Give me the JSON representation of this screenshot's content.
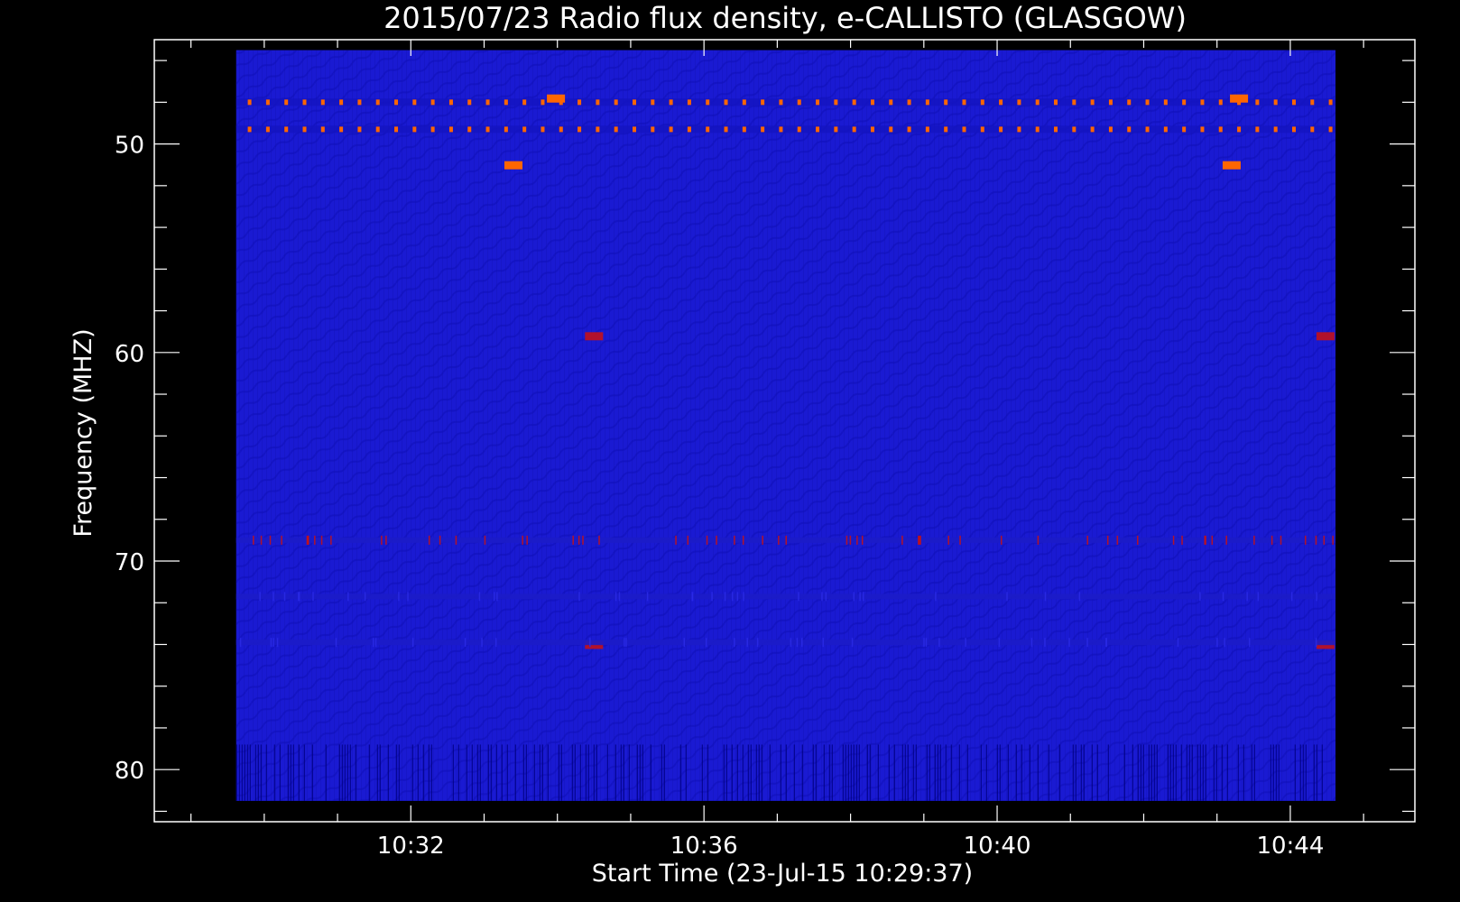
{
  "chart_data": {
    "type": "heatmap",
    "title": "2015/07/23  Radio flux density, e-CALLISTO (GLASGOW)",
    "xlabel": "Start Time (23-Jul-15 10:29:37)",
    "ylabel": "Frequency (MHZ)",
    "x_tick_labels": [
      "10:32",
      "10:36",
      "10:40",
      "10:44"
    ],
    "x_ticks_minutes": [
      32,
      36,
      40,
      44
    ],
    "y_tick_labels": [
      "50",
      "60",
      "70",
      "80"
    ],
    "y_ticks": [
      50,
      60,
      70,
      80
    ],
    "xlim_minutes": [
      28.5,
      45.7
    ],
    "ylim": [
      45,
      82.5
    ],
    "data_extent": {
      "time_start_minutes": 29.617,
      "time_end_minutes": 44.617,
      "freq_top": 45.5,
      "freq_bottom": 81.5
    },
    "y_inverted": true,
    "colormap": {
      "background": "#000000",
      "frame": "#ffffff",
      "low": "#1a1ad2",
      "mid": "#2a2ae6",
      "high": "#cc1111",
      "peak": "#ff6600"
    },
    "features": [
      {
        "kind": "periodic_dots",
        "frequency": 48.0,
        "t_start": 29.8,
        "t_end": 44.6,
        "period": 0.25,
        "level": "peak"
      },
      {
        "kind": "periodic_dots",
        "frequency": 49.3,
        "t_start": 29.8,
        "t_end": 44.6,
        "period": 0.25,
        "level": "peak"
      },
      {
        "kind": "spot",
        "frequency": 51.0,
        "time": 33.4,
        "level": "peak"
      },
      {
        "kind": "spot",
        "frequency": 51.0,
        "time": 43.2,
        "level": "peak"
      },
      {
        "kind": "spot",
        "frequency": 47.8,
        "time": 33.98,
        "level": "peak"
      },
      {
        "kind": "spot",
        "frequency": 47.8,
        "time": 43.3,
        "level": "peak"
      },
      {
        "kind": "spot",
        "frequency": 59.2,
        "time": 34.5,
        "level": "high"
      },
      {
        "kind": "spot",
        "frequency": 59.2,
        "time": 44.48,
        "level": "high"
      },
      {
        "kind": "spot",
        "frequency": 74.0,
        "time": 34.5,
        "level": "high"
      },
      {
        "kind": "spot",
        "frequency": 74.0,
        "time": 44.48,
        "level": "high"
      },
      {
        "kind": "band",
        "frequency": 69.0,
        "level": "high"
      },
      {
        "kind": "band",
        "frequency": 71.7,
        "level": "mid"
      },
      {
        "kind": "band",
        "frequency": 73.9,
        "level": "mid"
      },
      {
        "kind": "dark_stripes",
        "freq_from": 78.8,
        "freq_to": 81.5
      }
    ]
  }
}
